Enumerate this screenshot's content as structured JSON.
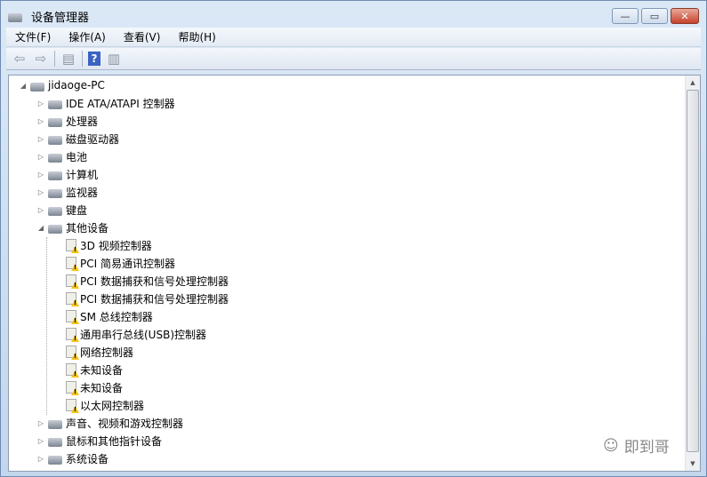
{
  "window": {
    "title": "设备管理器",
    "minimize": "—",
    "maximize": "▭",
    "close": "✕"
  },
  "menu": [
    "文件(F)",
    "操作(A)",
    "查看(V)",
    "帮助(H)"
  ],
  "toolbar": {
    "help": "?"
  },
  "tree": {
    "root": "jidaoge-PC",
    "categories": [
      {
        "label": "IDE ATA/ATAPI 控制器",
        "expanded": false
      },
      {
        "label": "处理器",
        "expanded": false
      },
      {
        "label": "磁盘驱动器",
        "expanded": false
      },
      {
        "label": "电池",
        "expanded": false
      },
      {
        "label": "计算机",
        "expanded": false
      },
      {
        "label": "监视器",
        "expanded": false
      },
      {
        "label": "键盘",
        "expanded": false
      },
      {
        "label": "其他设备",
        "expanded": true
      },
      {
        "label": "声音、视频和游戏控制器",
        "expanded": false
      },
      {
        "label": "鼠标和其他指针设备",
        "expanded": false
      },
      {
        "label": "系统设备",
        "expanded": false
      }
    ],
    "other_devices": [
      "3D 视频控制器",
      "PCI 简易通讯控制器",
      "PCI 数据捕获和信号处理控制器",
      "PCI 数据捕获和信号处理控制器",
      "SM 总线控制器",
      "通用串行总线(USB)控制器",
      "网络控制器",
      "未知设备",
      "未知设备",
      "以太网控制器"
    ]
  },
  "watermark": "即到哥"
}
